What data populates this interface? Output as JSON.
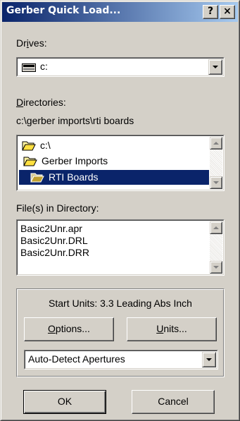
{
  "window": {
    "title": "Gerber Quick Load...",
    "help_label": "?",
    "close_label": "×"
  },
  "drives": {
    "label_pre": "Dr",
    "label_u": "i",
    "label_post": "ves:",
    "value": "c:"
  },
  "directories": {
    "label_u": "D",
    "label_post": "irectories:",
    "current_path": "c:\\gerber imports\\rti boards",
    "items": [
      {
        "label": "c:\\",
        "selected": false
      },
      {
        "label": "Gerber Imports",
        "selected": false
      },
      {
        "label": "RTI Boards",
        "selected": true
      }
    ]
  },
  "files": {
    "label": "File(s) in Directory:",
    "items": [
      "Basic2Unr.apr",
      "Basic2Unr.DRL",
      "Basic2Unr.DRR"
    ]
  },
  "settings": {
    "start_units": "Start Units:  3.3 Leading Abs Inch",
    "options_u": "O",
    "options_post": "ptions...",
    "units_u": "U",
    "units_post": "nits...",
    "aperture_mode": "Auto-Detect Apertures"
  },
  "actions": {
    "ok_label": "OK",
    "cancel_label": "Cancel"
  }
}
